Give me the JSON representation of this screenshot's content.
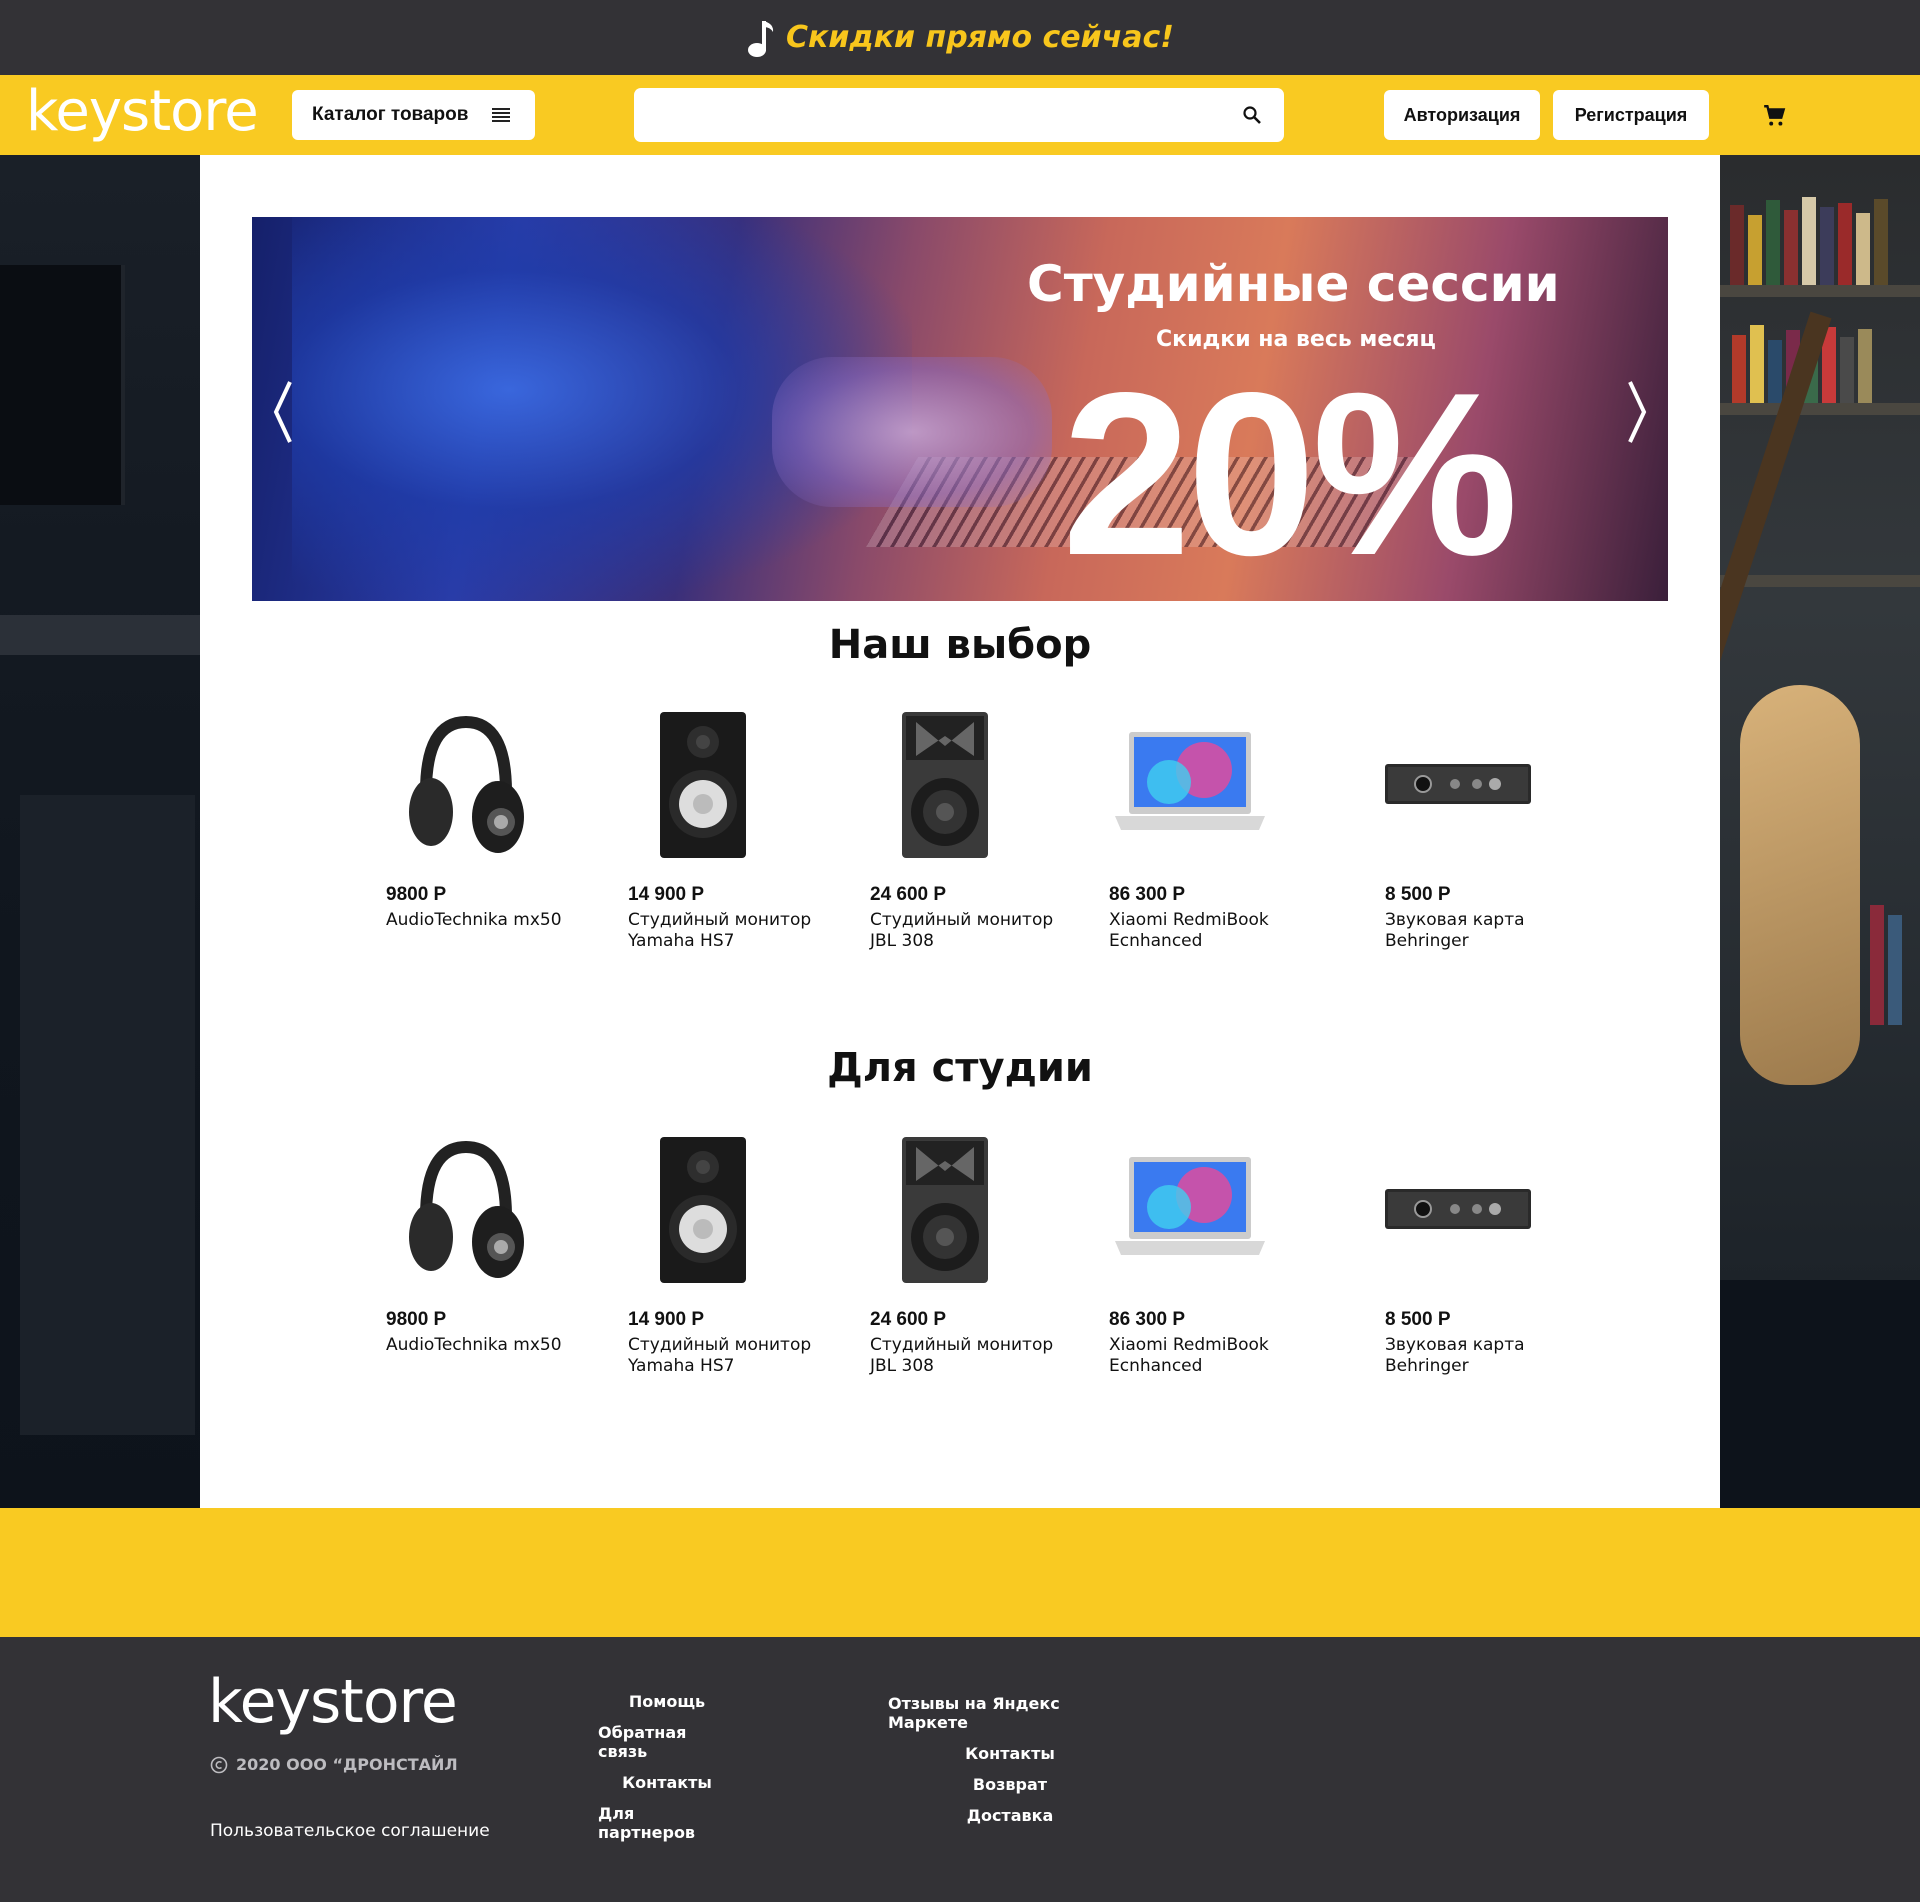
{
  "promo": {
    "text": "Скидки прямо сейчас!"
  },
  "header": {
    "logo": "keystore",
    "catalog_label": "Каталог товаров",
    "search_placeholder": "",
    "login_label": "Авторизация",
    "register_label": "Регистрация",
    "accent_color": "#f9ca22"
  },
  "banner": {
    "title": "Студийные сессии",
    "subtitle": "Скидки на весь месяц",
    "discount": "20%"
  },
  "sections": [
    {
      "title": "Наш выбор",
      "products": [
        {
          "price": "9800 Р",
          "name": "AudioTechnika mx50",
          "icon": "headphones-icon"
        },
        {
          "price": "14 900 Р",
          "name": "Студийный монитор Yamaha HS7",
          "icon": "studio-monitor-icon"
        },
        {
          "price": "24 600 Р",
          "name": "Студийный монитор JBL 308",
          "icon": "studio-monitor-icon"
        },
        {
          "price": "86 300 Р",
          "name": "Xiaomi RedmiBook Ecnhanced",
          "icon": "laptop-icon"
        },
        {
          "price": "8 500 Р",
          "name": "Звуковая карта Behringer",
          "icon": "sound-card-icon"
        }
      ]
    },
    {
      "title": "Для студии",
      "products": [
        {
          "price": "9800 Р",
          "name": "AudioTechnika mx50",
          "icon": "headphones-icon"
        },
        {
          "price": "14 900 Р",
          "name": "Студийный монитор Yamaha HS7",
          "icon": "studio-monitor-icon"
        },
        {
          "price": "24 600 Р",
          "name": "Студийный монитор JBL 308",
          "icon": "studio-monitor-icon"
        },
        {
          "price": "86 300 Р",
          "name": "Xiaomi RedmiBook Ecnhanced",
          "icon": "laptop-icon"
        },
        {
          "price": "8 500 Р",
          "name": "Звуковая карта Behringer",
          "icon": "sound-card-icon"
        }
      ]
    }
  ],
  "footer": {
    "logo": "keystore",
    "copyright": "2020 ООО “ДРОНСТАЙЛ",
    "agreement": "Пользовательское соглашение",
    "col1": [
      "Помощь",
      "Обратная связь",
      "Контакты",
      "Для партнеров"
    ],
    "col2": [
      "Отзывы на Яндекс Маркете",
      "Контакты",
      "Возврат",
      "Доставка"
    ]
  }
}
